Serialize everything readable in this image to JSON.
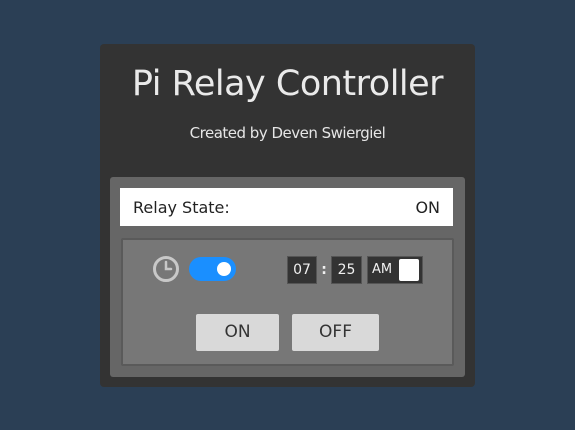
{
  "header": {
    "title": "Pi Relay Controller",
    "subtitle": "Created by Deven Swiergiel"
  },
  "relay": {
    "state_label": "Relay State:",
    "state_value": "ON"
  },
  "schedule": {
    "clock_icon": "clock-icon",
    "timer_enabled": true,
    "hour": "07",
    "separator": ":",
    "minute": "25",
    "period": "AM",
    "period_checked": false
  },
  "controls": {
    "on_label": "ON",
    "off_label": "OFF"
  },
  "colors": {
    "background": "#2b3f55",
    "card": "#333333",
    "toggle_on": "#1a8fff"
  }
}
